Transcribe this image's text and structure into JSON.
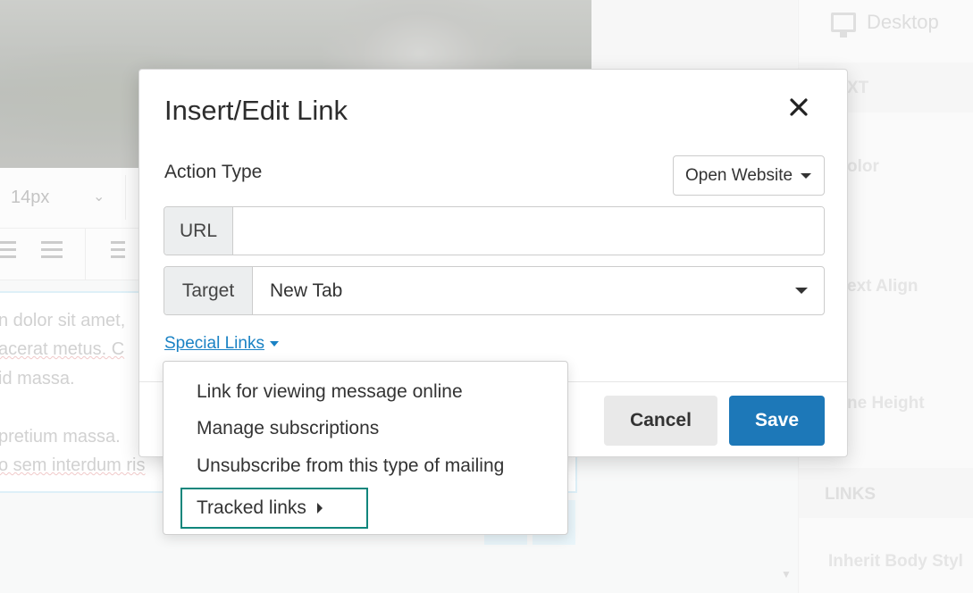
{
  "background": {
    "font_size": "14px",
    "editor_lines": [
      "n dolor sit amet,",
      "acerat metus. C",
      "id massa.",
      "",
      "pretium massa.",
      "o sem interdum ris"
    ],
    "right_panel": {
      "device": "Desktop",
      "sections": [
        "XT",
        "olor",
        "ext Align",
        "ne Height",
        "LINKS",
        "Inherit Body Styl"
      ]
    }
  },
  "modal": {
    "title": "Insert/Edit Link",
    "action_type_label": "Action Type",
    "action_type_value": "Open Website",
    "url_label": "URL",
    "url_value": "",
    "target_label": "Target",
    "target_value": "New Tab",
    "special_links_label": "Special Links",
    "cancel_label": "Cancel",
    "save_label": "Save"
  },
  "dropdown": {
    "items": [
      "Link for viewing message online",
      "Manage subscriptions",
      "Unsubscribe from this type of mailing"
    ],
    "tracked_label": "Tracked links"
  },
  "colors": {
    "accent": "#1d78b8",
    "link": "#1a82c4",
    "focus_outline": "#10867c"
  },
  "icons": {
    "close": "close-icon",
    "action_caret": "caret-down-icon",
    "target_caret": "caret-down-icon",
    "special_links_caret": "caret-down-icon",
    "tracked_caret": "caret-right-icon",
    "device": "monitor-icon"
  }
}
